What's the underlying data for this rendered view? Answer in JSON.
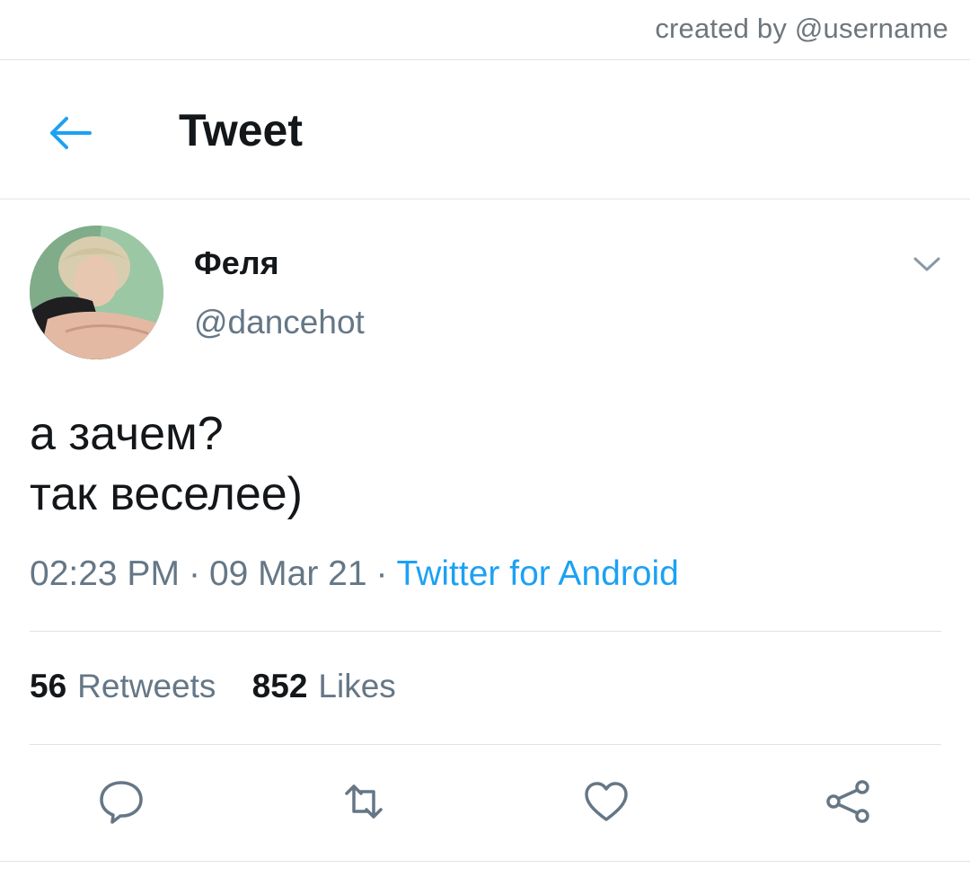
{
  "credit": "created by @username",
  "header": {
    "title": "Tweet"
  },
  "author": {
    "name": "Феля",
    "handle": "@dancehot"
  },
  "tweet": {
    "lines": [
      "а зачем?",
      "так веселее)"
    ],
    "time": "02:23 PM",
    "date": "09 Mar 21",
    "separator": "·",
    "source": "Twitter for Android"
  },
  "stats": {
    "retweets_count": "56",
    "retweets_label": "Retweets",
    "likes_count": "852",
    "likes_label": "Likes"
  },
  "colors": {
    "accent": "#1da1f2",
    "text": "#14171a",
    "secondary": "#657786",
    "divider": "#dfe3e6"
  },
  "icons": {
    "back": "arrow-left-icon",
    "caret": "chevron-down-icon",
    "reply": "reply-icon",
    "retweet": "retweet-icon",
    "like": "heart-icon",
    "share": "share-icon"
  }
}
